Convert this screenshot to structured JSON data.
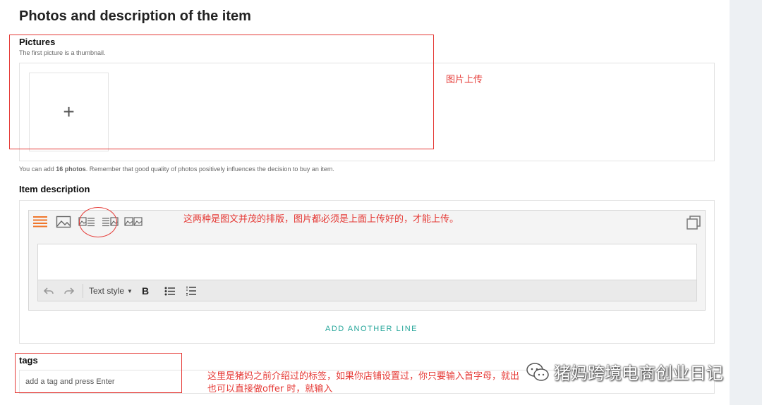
{
  "page": {
    "title": "Photos and description of the item"
  },
  "pictures": {
    "label": "Pictures",
    "hint": "The first picture is a thumbnail.",
    "footer_prefix": "You can add ",
    "footer_count": "16 photos",
    "footer_suffix": ". Remember that good quality of photos positively influences the decision to buy an item.",
    "add_symbol": "+"
  },
  "description": {
    "label": "Item description",
    "layout_buttons": [
      "text-only-layout",
      "image-only-layout",
      "image-left-text-layout",
      "text-image-right-layout",
      "two-images-layout"
    ],
    "format_toolbar": {
      "text_style_label": "Text style",
      "bold_label": "B"
    },
    "add_line_label": "ADD ANOTHER LINE"
  },
  "tags": {
    "label": "tags",
    "placeholder": "add a tag and press Enter"
  },
  "annotations": {
    "photo_upload_note": "图片上传",
    "layout_note": "这两种是图文并茂的排版，图片都必须是上面上传好的，才能上传。",
    "tags_note_line1": "这里是猪妈之前介绍过的标签，如果你店铺设置过，你只要输入首字母，就出",
    "tags_note_line2": "也可以直接做offer 时，就输入"
  },
  "watermark": {
    "text": "猪妈跨境电商创业日记"
  },
  "colors": {
    "accent": "#26a69a",
    "annotation": "#e53935",
    "active_layout": "#f0762b"
  }
}
